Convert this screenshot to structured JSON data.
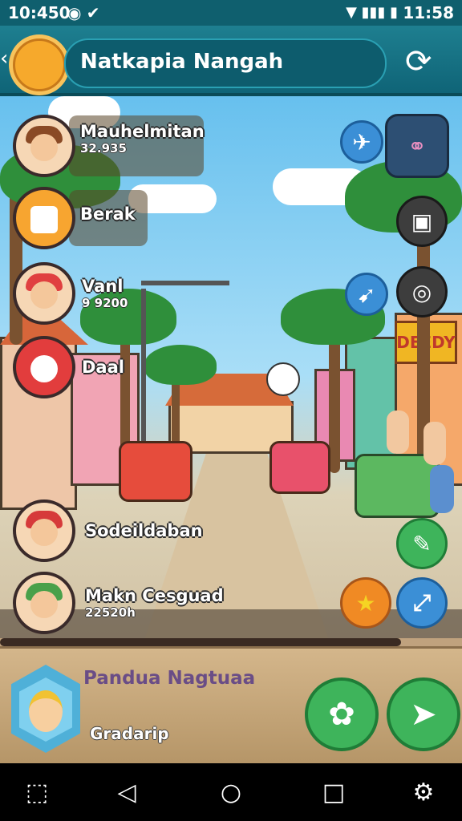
{
  "status": {
    "time_left": "10:450",
    "time_right": "11:58"
  },
  "header": {
    "title": "Natkapia Nangah"
  },
  "list": [
    {
      "name": "Mauhelmitan",
      "sub": "32.935"
    },
    {
      "name": "Berak",
      "sub": ""
    },
    {
      "name": "Vanl",
      "sub": "9 9200"
    },
    {
      "name": "Daal",
      "sub": ""
    },
    {
      "name": "Sodeildaban",
      "sub": ""
    },
    {
      "name": "Makn Cesguad",
      "sub": "22520h"
    }
  ],
  "panel": {
    "title": "Pandua Nagtuaa",
    "subtitle": "Gradarip"
  },
  "scene": {
    "shop_sign": "DEEDY"
  },
  "colors": {
    "header": "#1e7f90",
    "accent_green": "#3eb45b",
    "orange": "#f08a24",
    "blue": "#3b8fd6"
  }
}
